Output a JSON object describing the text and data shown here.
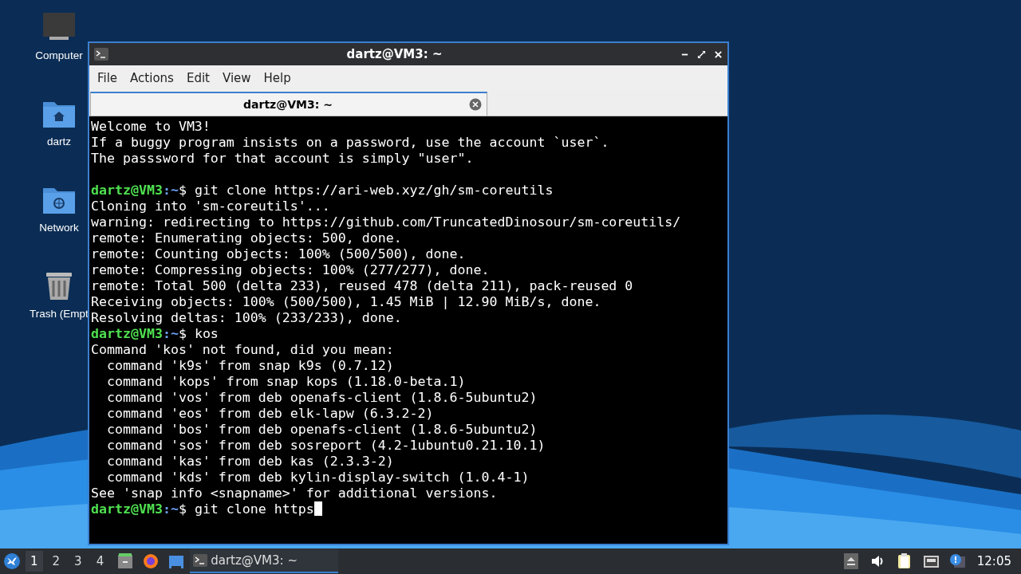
{
  "desktop_icons": [
    {
      "kind": "computer",
      "label": "Computer"
    },
    {
      "kind": "home",
      "label": "dartz"
    },
    {
      "kind": "network",
      "label": "Network"
    },
    {
      "kind": "trash",
      "label": "Trash (Empt"
    }
  ],
  "window": {
    "title": "dartz@VM3: ~"
  },
  "menu": [
    "File",
    "Actions",
    "Edit",
    "View",
    "Help"
  ],
  "tabs": [
    {
      "label": "dartz@VM3: ~",
      "selected": true
    }
  ],
  "terminal": {
    "lines": [
      {
        "kind": "output",
        "text": "Welcome to VM3!"
      },
      {
        "kind": "output",
        "text": "If a buggy program insists on a password, use the account `user`."
      },
      {
        "kind": "output",
        "text": "The passsword for that account is simply \"user\"."
      },
      {
        "kind": "prompt",
        "gap_before": true,
        "user_host": "dartz@VM3",
        "path": ":~",
        "command": "$ git clone https://ari-web.xyz/gh/sm-coreutils"
      },
      {
        "kind": "output",
        "text": "Cloning into 'sm-coreutils'..."
      },
      {
        "kind": "output",
        "text": "warning: redirecting to https://github.com/TruncatedDinosour/sm-coreutils/"
      },
      {
        "kind": "output",
        "text": "remote: Enumerating objects: 500, done."
      },
      {
        "kind": "output",
        "text": "remote: Counting objects: 100% (500/500), done."
      },
      {
        "kind": "output",
        "text": "remote: Compressing objects: 100% (277/277), done."
      },
      {
        "kind": "output",
        "text": "remote: Total 500 (delta 233), reused 478 (delta 211), pack-reused 0"
      },
      {
        "kind": "output",
        "text": "Receiving objects: 100% (500/500), 1.45 MiB | 12.90 MiB/s, done."
      },
      {
        "kind": "output",
        "text": "Resolving deltas: 100% (233/233), done."
      },
      {
        "kind": "prompt",
        "user_host": "dartz@VM3",
        "path": ":~",
        "command": "$ kos"
      },
      {
        "kind": "output",
        "text": "Command 'kos' not found, did you mean:"
      },
      {
        "kind": "output",
        "text": "  command 'k9s' from snap k9s (0.7.12)"
      },
      {
        "kind": "output",
        "text": "  command 'kops' from snap kops (1.18.0-beta.1)"
      },
      {
        "kind": "output",
        "text": "  command 'vos' from deb openafs-client (1.8.6-5ubuntu2)"
      },
      {
        "kind": "output",
        "text": "  command 'eos' from deb elk-lapw (6.3.2-2)"
      },
      {
        "kind": "output",
        "text": "  command 'bos' from deb openafs-client (1.8.6-5ubuntu2)"
      },
      {
        "kind": "output",
        "text": "  command 'sos' from deb sosreport (4.2-1ubuntu0.21.10.1)"
      },
      {
        "kind": "output",
        "text": "  command 'kas' from deb kas (2.3.3-2)"
      },
      {
        "kind": "output",
        "text": "  command 'kds' from deb kylin-display-switch (1.0.4-1)"
      },
      {
        "kind": "output",
        "text": "See 'snap info <snapname>' for additional versions."
      },
      {
        "kind": "prompt",
        "user_host": "dartz@VM3",
        "path": ":~",
        "command": "$ git clone https",
        "cursor": true
      }
    ]
  },
  "taskbar": {
    "workspaces": [
      {
        "label": "1",
        "selected": true
      },
      {
        "label": "2",
        "selected": false
      },
      {
        "label": "3",
        "selected": false
      },
      {
        "label": "4",
        "selected": false
      }
    ],
    "tasks": [
      {
        "label": "dartz@VM3: ~",
        "selected": true
      }
    ],
    "clock": "12:05"
  }
}
